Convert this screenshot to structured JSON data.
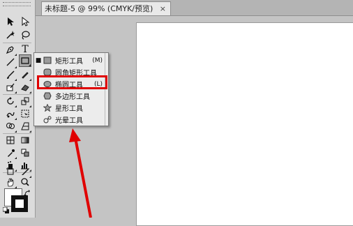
{
  "document": {
    "tab_title": "未标题-5 @ 99% (CMYK/预览)",
    "close_glyph": "×"
  },
  "flyout": {
    "items": [
      {
        "label": "矩形工具",
        "shortcut": "(M)",
        "selected": true,
        "icon": "rectangle-icon"
      },
      {
        "label": "圆角矩形工具",
        "shortcut": "",
        "selected": false,
        "icon": "rounded-rectangle-icon"
      },
      {
        "label": "椭圆工具",
        "shortcut": "(L)",
        "selected": false,
        "icon": "ellipse-icon"
      },
      {
        "label": "多边形工具",
        "shortcut": "",
        "selected": false,
        "icon": "polygon-icon"
      },
      {
        "label": "星形工具",
        "shortcut": "",
        "selected": false,
        "icon": "star-icon"
      },
      {
        "label": "光晕工具",
        "shortcut": "",
        "selected": false,
        "icon": "flare-icon"
      }
    ],
    "bullet": "■"
  },
  "toolbar": {
    "type_label": "T"
  },
  "colors": {
    "highlight": "#e00000",
    "arrow": "#e00000",
    "fill": "#ffffff",
    "stroke": "#111111"
  }
}
